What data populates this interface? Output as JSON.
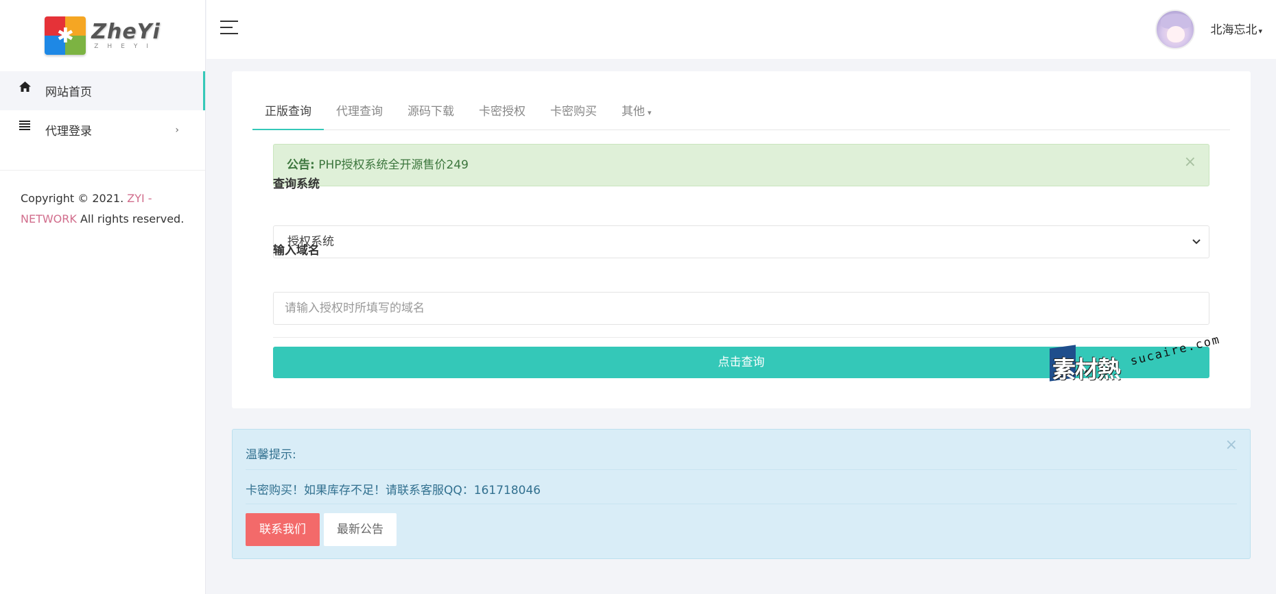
{
  "logo": {
    "title": "ZheYi",
    "subtitle": "ZHEYI"
  },
  "sidebar": {
    "items": [
      {
        "label": "网站首页",
        "icon": "home-icon",
        "active": true
      },
      {
        "label": "代理登录",
        "icon": "list-icon",
        "chevron": "›"
      }
    ],
    "copyright": {
      "prefix": "Copyright © 2021.",
      "brand": " ZYI - NETWORK",
      "suffix": " All rights reserved."
    }
  },
  "header": {
    "user_name": "北海忘北",
    "caret": "▾"
  },
  "tabs": [
    {
      "label": "正版查询",
      "active": true
    },
    {
      "label": "代理查询"
    },
    {
      "label": "源码下载"
    },
    {
      "label": "卡密授权"
    },
    {
      "label": "卡密购买"
    },
    {
      "label": "其他",
      "caret": "▾"
    }
  ],
  "notice": {
    "prefix": "公告:",
    "text": " PHP授权系统全开源售价249",
    "close": "×"
  },
  "form": {
    "system_label": "查询系统",
    "system_value": "授权系统",
    "domain_label": "输入域名",
    "domain_placeholder": "请输入授权时所填写的域名",
    "submit_label": "点击查询"
  },
  "watermark": {
    "chars": "素材熱",
    "url": "sucaire.com"
  },
  "info": {
    "title": "温馨提示:",
    "message": "卡密购买！如果库存不足！请联系客服QQ：161718046",
    "close": "×",
    "contact_label": "联系我们",
    "news_label": "最新公告"
  },
  "colors": {
    "accent": "#34c8b8",
    "success_bg": "#dff0d8",
    "info_bg": "#d9edf7",
    "danger": "#f36a6a"
  }
}
